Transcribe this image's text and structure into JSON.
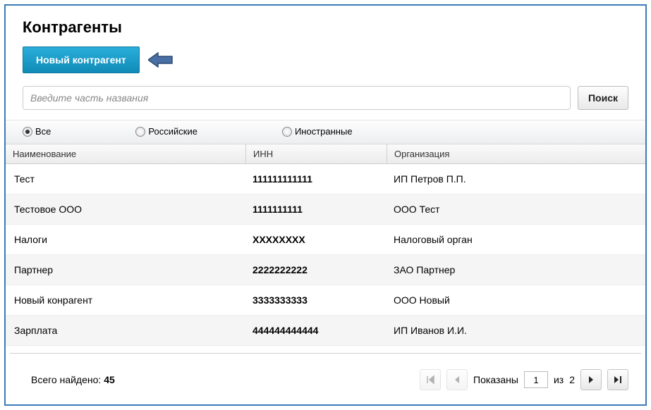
{
  "page_title": "Контрагенты",
  "new_button_label": "Новый контрагент",
  "search_placeholder": "Введите часть названия",
  "search_button_label": "Поиск",
  "filters": {
    "all": "Все",
    "russian": "Российские",
    "foreign": "Иностранные",
    "selected": "all"
  },
  "columns": {
    "name": "Наименование",
    "inn": "ИНН",
    "org": "Организация"
  },
  "rows": [
    {
      "name": "Тест",
      "inn": "111111111111",
      "org": "ИП Петров П.П."
    },
    {
      "name": "Тестовое ООО",
      "inn": "1111111111",
      "org": "ООО Тест"
    },
    {
      "name": "Налоги",
      "inn": "ХХХХХХХХ",
      "org": "Налоговый орган"
    },
    {
      "name": "Партнер",
      "inn": "2222222222",
      "org": "ЗАО Партнер"
    },
    {
      "name": "Новый конрагент",
      "inn": "3333333333",
      "org": "ООО Новый"
    },
    {
      "name": "Зарплата",
      "inn": "444444444444",
      "org": "ИП Иванов И.И."
    }
  ],
  "footer": {
    "total_label": "Всего найдено:",
    "total_count": "45",
    "shown_label": "Показаны",
    "page_current": "1",
    "of_label": "из",
    "page_total": "2"
  }
}
